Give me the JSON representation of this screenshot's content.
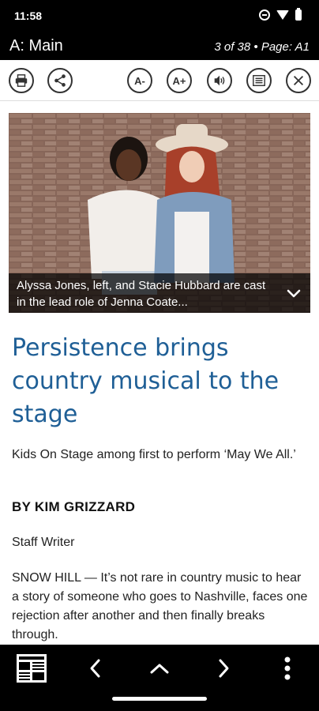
{
  "status_bar": {
    "time": "11:58",
    "icons": [
      "dnd-icon",
      "wifi-icon",
      "battery-icon"
    ]
  },
  "header": {
    "section": "A: Main",
    "page_info": "3 of 38 • Page: A1"
  },
  "toolbar": {
    "buttons": [
      "print-icon",
      "share-icon",
      "decrease-font-button",
      "increase-font-button",
      "speaker-icon",
      "text-view-icon",
      "close-icon"
    ],
    "font_decrease_label": "A-",
    "font_increase_label": "A+"
  },
  "photo": {
    "caption": "Alyssa Jones, left, and Stacie Hubbard are cast in the lead role of Jenna Coate..."
  },
  "article": {
    "headline": "Persistence brings country musical to the stage",
    "subhead": "Kids On Stage among first to perform ‘May We All.’",
    "byline": "BY KIM GRIZZARD",
    "role": "Staff Writer",
    "body": "SNOW HILL — It’s not rare in country music to hear a story of someone who goes to Nashville, faces one rejection after another and then finally breaks through."
  },
  "bottom_bar": {
    "buttons": [
      "page-thumbnails-icon",
      "previous-icon",
      "up-icon",
      "next-icon",
      "more-icon"
    ]
  },
  "colors": {
    "headline": "#1f5f96",
    "bars": "#000000"
  }
}
